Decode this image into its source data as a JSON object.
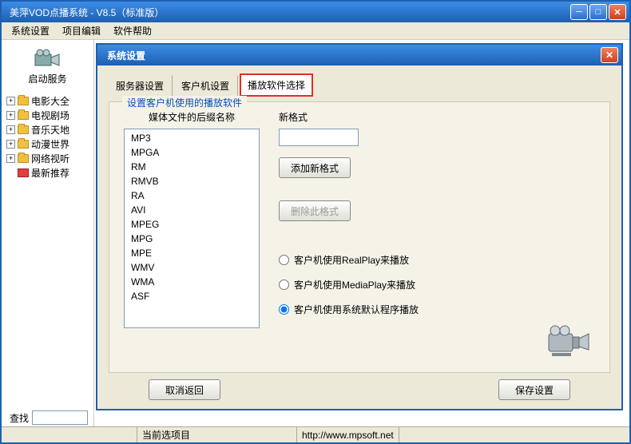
{
  "window": {
    "title": "美萍VOD点播系统 - V8.5（标准版）"
  },
  "menu": {
    "items": [
      "系统设置",
      "项目编辑",
      "软件帮助"
    ]
  },
  "sidebar": {
    "start_label": "启动服务",
    "tree": [
      {
        "label": "电影大全"
      },
      {
        "label": "电视剧场"
      },
      {
        "label": "音乐天地"
      },
      {
        "label": "动漫世界"
      },
      {
        "label": "网络视听"
      },
      {
        "label": "最新推荐"
      }
    ]
  },
  "search": {
    "label": "查找",
    "value": ""
  },
  "status": {
    "current_label": "当前选项目",
    "url": "http://www.mpsoft.net"
  },
  "dialog": {
    "title": "系统设置",
    "tabs": [
      "服务器设置",
      "客户机设置",
      "播放软件选择"
    ],
    "active_tab": 2,
    "group_legend": "设置客户机使用的播放软件",
    "media_ext_label": "媒体文件的后缀名称",
    "extensions": [
      "MP3",
      "MPGA",
      "RM",
      "RMVB",
      "RA",
      "AVI",
      "MPEG",
      "MPG",
      "MPE",
      "WMV",
      "WMA",
      "ASF"
    ],
    "new_format_label": "新格式",
    "new_format_value": "",
    "add_format_btn": "添加新格式",
    "delete_format_btn": "删除此格式",
    "radios": [
      "客户机使用RealPlay来播放",
      "客户机使用MediaPlay来播放",
      "客户机使用系统默认程序播放"
    ],
    "selected_radio": 2,
    "cancel_btn": "取消返回",
    "save_btn": "保存设置"
  }
}
